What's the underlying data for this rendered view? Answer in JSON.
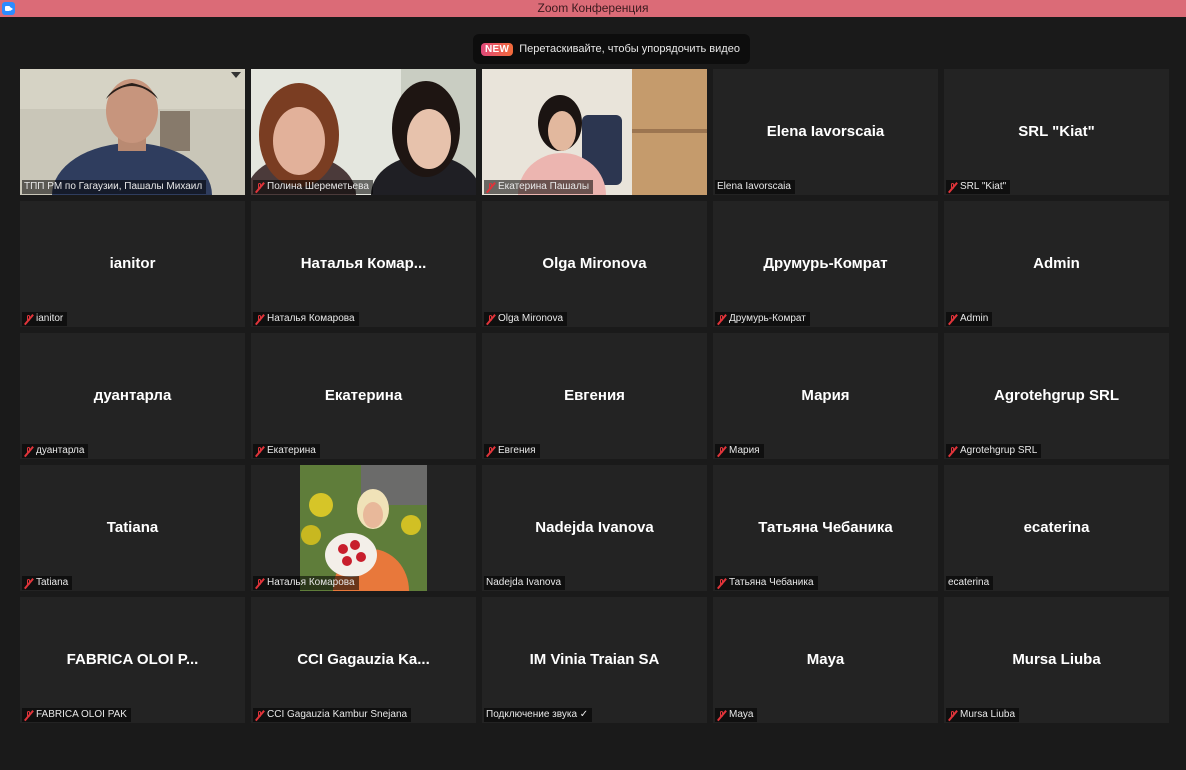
{
  "window": {
    "title": "Zoom Конференция"
  },
  "tooltip": {
    "badge": "NEW",
    "text": "Перетаскивайте, чтобы упорядочить видео"
  },
  "colors": {
    "titlebar": "#db6b77",
    "active_border": "#c9e24a",
    "tile_bg": "#232323",
    "muted_icon": "#e0343a"
  },
  "participants": [
    {
      "name": "ТПП РМ по Гагаузии, Пашалы Михаил",
      "display": "",
      "video": "man-video",
      "muted": false,
      "active": true
    },
    {
      "name": "Полина Шереметьева",
      "display": "",
      "video": "two-women-video",
      "muted": true
    },
    {
      "name": "Екатерина Пашалы",
      "display": "",
      "video": "woman-office-video",
      "muted": true
    },
    {
      "name": "Elena Iavorscaia",
      "display": "Elena Iavorscaia",
      "muted": false
    },
    {
      "name": "SRL \"Kiat\"",
      "display": "SRL \"Kiat\"",
      "muted": true
    },
    {
      "name": "ianitor",
      "display": "ianitor",
      "muted": true
    },
    {
      "name": "Наталья Комарова",
      "display": "Наталья  Комар...",
      "muted": true
    },
    {
      "name": "Olga Mironova",
      "display": "Olga Mironova",
      "muted": true
    },
    {
      "name": "Друмурь-Комрат",
      "display": "Друмурь-Комрат",
      "muted": true
    },
    {
      "name": "Admin",
      "display": "Admin",
      "muted": true
    },
    {
      "name": "дуантарла",
      "display": "дуантарла",
      "muted": true
    },
    {
      "name": "Екатерина",
      "display": "Екатерина",
      "muted": true
    },
    {
      "name": "Евгения",
      "display": "Евгения",
      "muted": true
    },
    {
      "name": "Мария",
      "display": "Мария",
      "muted": true
    },
    {
      "name": "Agrotehgrup SRL",
      "display": "Agrotehgrup SRL",
      "muted": true
    },
    {
      "name": "Tatiana",
      "display": "Tatiana",
      "muted": true
    },
    {
      "name": "Наталья Комарова",
      "display": "",
      "video": "profile-photo-flowers",
      "muted": true
    },
    {
      "name": "Nadejda Ivanova",
      "display": "Nadejda Ivanova",
      "muted": false
    },
    {
      "name": "Татьяна Чебаника",
      "display": "Татьяна Чебаника",
      "muted": true
    },
    {
      "name": "ecaterina",
      "display": "ecaterina",
      "muted": false
    },
    {
      "name": "FABRICA OLOI PAK",
      "display": "FABRICA OLOI P...",
      "muted": true
    },
    {
      "name": "CCI Gagauzia Kambur Snejana",
      "display": "CCI Gagauzia Ka...",
      "muted": true
    },
    {
      "name": "Подключение звука ✓",
      "display": "IM Vinia Traian SA",
      "muted": false
    },
    {
      "name": "Maya",
      "display": "Maya",
      "muted": true
    },
    {
      "name": "Mursa Liuba",
      "display": "Mursa Liuba",
      "muted": true
    }
  ]
}
